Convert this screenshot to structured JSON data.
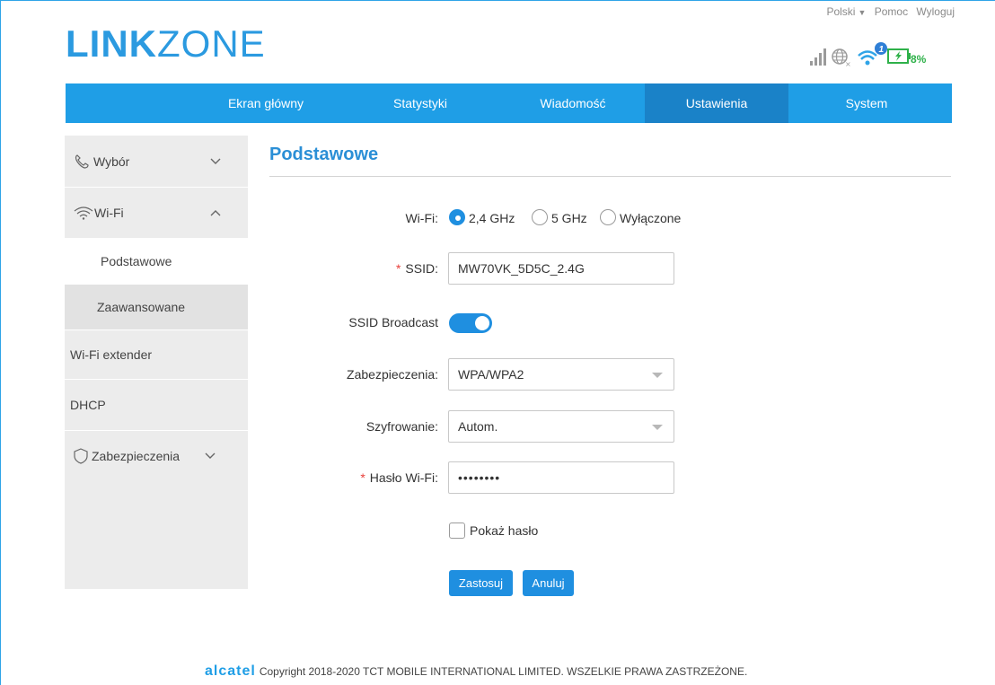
{
  "header": {
    "logo_bold": "LINK",
    "logo_light": "ZONE",
    "language": "Polski",
    "help": "Pomoc",
    "logout": "Wyloguj",
    "sms_badge": "1",
    "battery_percent": "8%"
  },
  "nav": {
    "items": [
      "Ekran główny",
      "Statystyki",
      "Wiadomość",
      "Ustawienia",
      "System"
    ],
    "active": "Ustawienia"
  },
  "sidebar": {
    "wybor": "Wybór",
    "wifi": "Wi-Fi",
    "podstawowe": "Podstawowe",
    "zaawansowane": "Zaawansowane",
    "wifi_extender": "Wi-Fi extender",
    "dhcp": "DHCP",
    "zabezpieczenia": "Zabezpieczenia"
  },
  "content": {
    "title": "Podstawowe",
    "wifi_label": "Wi-Fi:",
    "wifi_options": [
      "2,4 GHz",
      "5 GHz",
      "Wyłączone"
    ],
    "wifi_selected": "2,4 GHz",
    "ssid_label": "SSID:",
    "ssid_value": "MW70VK_5D5C_2.4G",
    "broadcast_label": "SSID Broadcast",
    "broadcast_on": true,
    "security_label": "Zabezpieczenia:",
    "security_value": "WPA/WPA2",
    "encryption_label": "Szyfrowanie:",
    "encryption_value": "Autom.",
    "password_label": "Hasło Wi-Fi:",
    "password_value": "••••••••",
    "show_password": "Pokaż hasło",
    "apply": "Zastosuj",
    "cancel": "Anuluj",
    "required_mark": "*"
  },
  "footer": {
    "brand": "alcatel",
    "copyright": "Copyright 2018-2020 TCT MOBILE INTERNATIONAL LIMITED. WSZELKIE PRAWA ZASTRZEŻONE."
  },
  "colors": {
    "accent": "#1f9ee6",
    "nav_active": "#1a82c8",
    "required": "#e8403b",
    "battery": "#2fb14a"
  }
}
